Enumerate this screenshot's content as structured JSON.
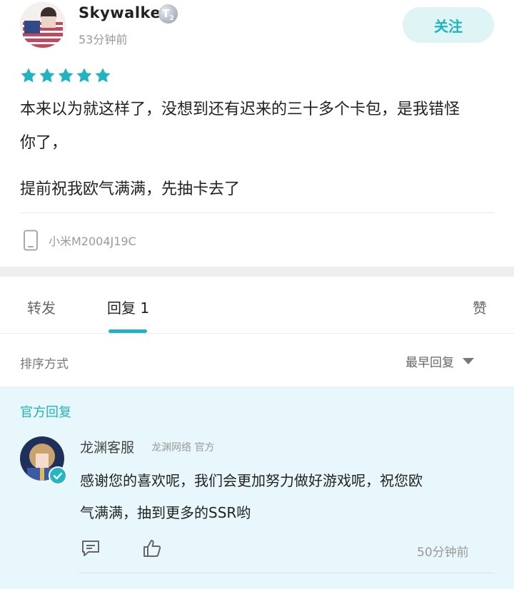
{
  "post": {
    "username": "Skywalker",
    "level_badge": "T",
    "level_num": "2",
    "time": "53分钟前",
    "follow_label": "关注",
    "rating_stars": 5,
    "paragraphs": [
      "本来以为就这样了，没想到还有迟来的三十多个卡包，是我错怪",
      "你了，",
      "提前祝我欧气满满，先抽卡去了"
    ],
    "device": "小米M2004J19C"
  },
  "tabs": {
    "repost": "转发",
    "reply": "回复 1",
    "like": "赞"
  },
  "sort": {
    "label": "排序方式",
    "value": "最早回复"
  },
  "official_reply": {
    "section_label": "官方回复",
    "name": "龙渊客服",
    "tag": "龙渊网络 官方",
    "lines": [
      "感谢您的喜欢呢，我们会更加努力做好游戏呢，祝您欧",
      "气满满，抽到更多的SSR哟"
    ],
    "time": "50分钟前"
  },
  "icons": [
    "phone-icon",
    "star-icon",
    "comment-icon",
    "thumbs-up-icon",
    "verified-icon",
    "caret-down-icon"
  ],
  "colors": {
    "accent": "#1fb4c0",
    "follow_bg": "#dff4f5",
    "official_bg": "#e8f7fb"
  }
}
